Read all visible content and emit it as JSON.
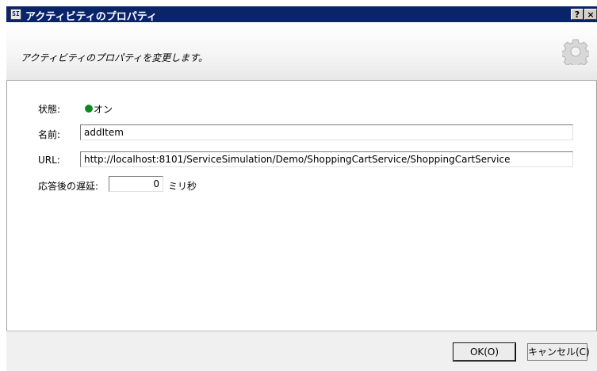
{
  "window": {
    "title": "アクティビティのプロパティ",
    "icon_text": "SI",
    "help_label": "?",
    "close_label": "×"
  },
  "header": {
    "description": "アクティビティのプロパティを変更します。",
    "icon": "gear-icon"
  },
  "form": {
    "status_label": "状態:",
    "status_value": "オン",
    "status_color": "#0b8a1f",
    "name_label": "名前:",
    "name_value": "addItem",
    "url_label": "URL:",
    "url_value": "http://localhost:8101/ServiceSimulation/Demo/ShoppingCartService/ShoppingCartService",
    "delay_label": "応答後の遅延:",
    "delay_value": "0",
    "delay_unit": "ミリ秒"
  },
  "buttons": {
    "ok_label": "OK(O)",
    "cancel_label": "キャンセル(C)"
  },
  "colors": {
    "titlebar": "#0a246a"
  }
}
